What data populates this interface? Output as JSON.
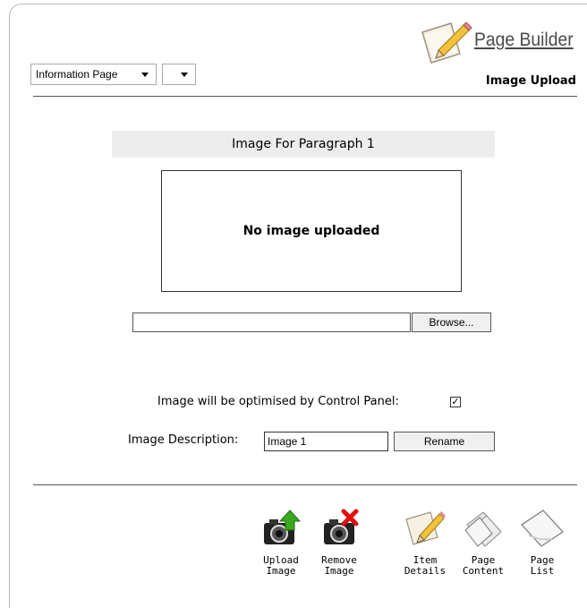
{
  "header": {
    "page_type_select": "Information Page",
    "page_type_select_2": "",
    "brand": "Page Builder",
    "page_heading": "Image Upload"
  },
  "main": {
    "section_title": "Image For Paragraph 1",
    "image_placeholder": "No image uploaded",
    "browse_label": "Browse...",
    "optimise_label": "Image will be optimised by Control Panel:",
    "optimise_checked": true,
    "description_label": "Image Description:",
    "description_value": "Image 1",
    "rename_label": "Rename"
  },
  "toolbar": {
    "upload_label": "Upload\nImage",
    "remove_label": "Remove\nImage",
    "item_details_label": "Item\nDetails",
    "page_content_label": "Page\nContent",
    "page_list_label": "Page\nList"
  },
  "icons": {
    "brand": "pencil-paper-icon",
    "upload": "camera-upload-icon",
    "remove": "camera-remove-icon",
    "item_details": "pencil-paper-icon",
    "page_content": "pages-stack-icon",
    "page_list": "page-icon"
  },
  "colors": {
    "upload_arrow": "#3aa81e",
    "remove_cross": "#e01010",
    "section_band": "#ededed"
  }
}
